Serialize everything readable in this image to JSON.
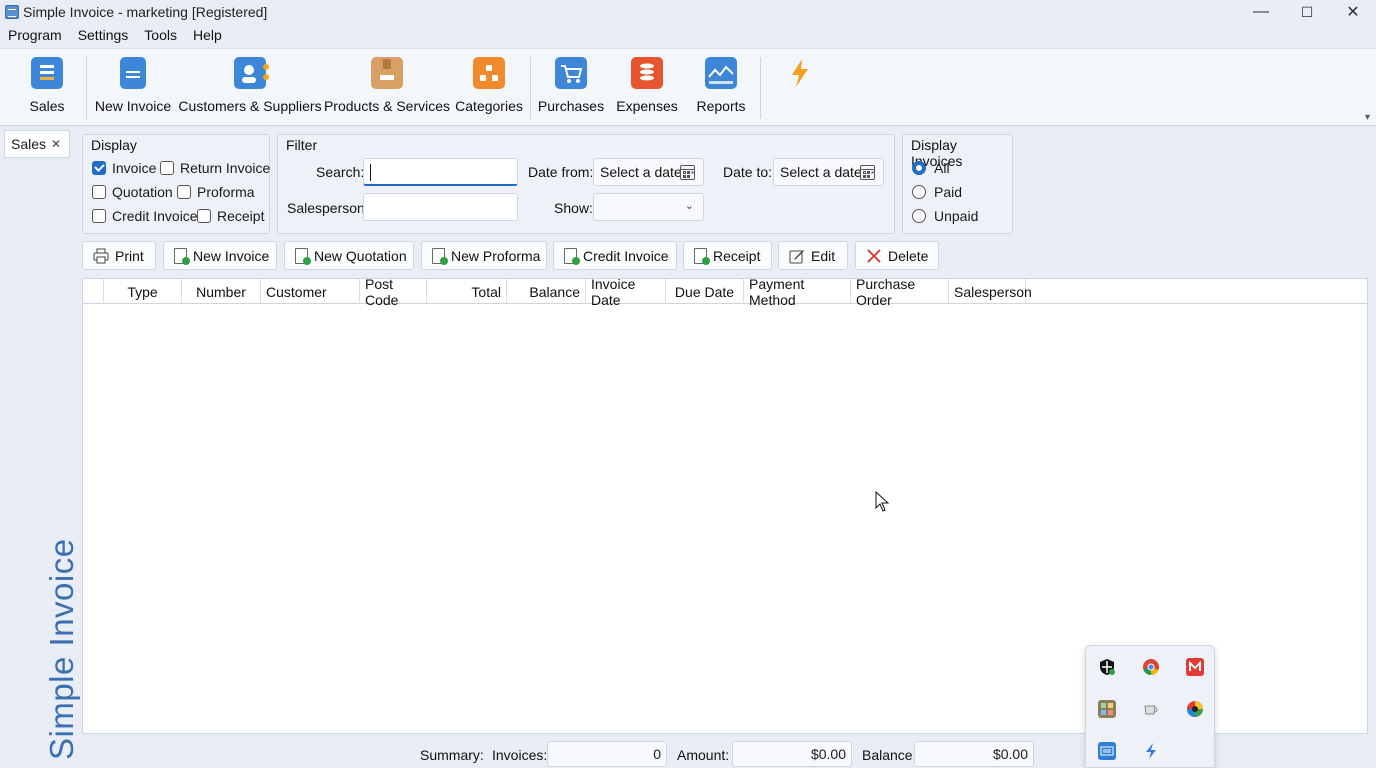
{
  "window": {
    "title": "Simple Invoice - marketing  [Registered]",
    "controls": {
      "minimize": "—",
      "maximize": "☐",
      "close": "✕"
    }
  },
  "menu": [
    "Program",
    "Settings",
    "Tools",
    "Help"
  ],
  "ribbon": {
    "items": [
      {
        "label": "Sales",
        "icon": "sales-icon",
        "color": "#3d86d8"
      },
      {
        "label": "New Invoice",
        "icon": "new-invoice-icon",
        "color": "#3d86d8"
      },
      {
        "label": "Customers & Suppliers",
        "icon": "contacts-icon",
        "color": "#3d86d8"
      },
      {
        "label": "Products & Services",
        "icon": "product-box-icon",
        "color": "#d9a066"
      },
      {
        "label": "Categories",
        "icon": "categories-icon",
        "color": "#f08a2c"
      },
      {
        "label": "Purchases",
        "icon": "cart-icon",
        "color": "#3d86d8"
      },
      {
        "label": "Expenses",
        "icon": "coins-icon",
        "color": "#e5552f"
      },
      {
        "label": "Reports",
        "icon": "chart-icon",
        "color": "#3d86d8"
      },
      {
        "label": "",
        "icon": "lightning-icon",
        "color": "#f2a21c"
      }
    ],
    "collapse_icon": "▾"
  },
  "tabs": {
    "active_label": "Sales",
    "close_glyph": "✕"
  },
  "brand_vertical": "Simple Invoice",
  "display_group": {
    "title": "Display",
    "options": [
      {
        "label": "Invoice",
        "checked": true
      },
      {
        "label": "Return Invoice",
        "checked": false
      },
      {
        "label": "Quotation",
        "checked": false
      },
      {
        "label": "Proforma",
        "checked": false
      },
      {
        "label": "Credit Invoice",
        "checked": false
      },
      {
        "label": "Receipt",
        "checked": false
      }
    ]
  },
  "filter": {
    "title": "Filter",
    "search_label": "Search:",
    "search_value": "",
    "salesperson_label": "Salesperson:",
    "salesperson_value": "",
    "date_from_label": "Date from:",
    "date_from_value": "Select a date",
    "date_to_label": "Date to:",
    "date_to_value": "Select a date",
    "show_label": "Show:",
    "show_value": ""
  },
  "display_invoices": {
    "title": "Display Invoices",
    "options": [
      {
        "label": "All",
        "checked": true
      },
      {
        "label": "Paid",
        "checked": false
      },
      {
        "label": "Unpaid",
        "checked": false
      }
    ]
  },
  "toolbar": {
    "print": "Print",
    "new_invoice": "New Invoice",
    "new_quotation": "New Quotation",
    "new_proforma": "New Proforma",
    "credit_invoice": "Credit Invoice",
    "receipt": "Receipt",
    "edit": "Edit",
    "delete": "Delete"
  },
  "table": {
    "columns": [
      "",
      "Type",
      "Number",
      "Customer",
      "Post Code",
      "Total",
      "Balance",
      "Invoice Date",
      "Due Date",
      "Payment Method",
      "Purchase Order",
      "Salesperson"
    ],
    "rows": []
  },
  "summary": {
    "label": "Summary:",
    "invoices_label": "Invoices:",
    "invoices_value": "0",
    "amount_label": "Amount:",
    "amount_value": "$0.00",
    "balance_label": "Balance:",
    "balance_value": "$0.00"
  },
  "tray_icons": [
    "shield-icon",
    "chrome-icon",
    "gmail-icon",
    "app-grid-icon",
    "coffee-cup-icon",
    "color-wheel-icon",
    "keyboard-icon",
    "lightning-icon"
  ]
}
